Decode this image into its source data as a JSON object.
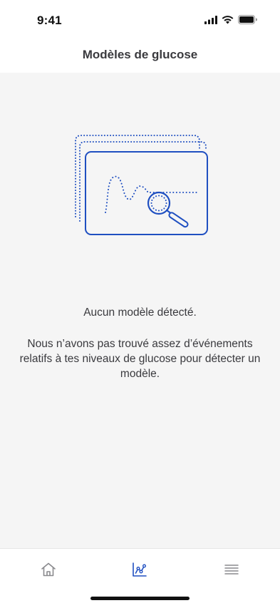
{
  "status_bar": {
    "time": "9:41",
    "icons": [
      "signal-icon",
      "wifi-icon",
      "battery-icon"
    ]
  },
  "header": {
    "title": "Modèles de glucose"
  },
  "empty_state": {
    "illustration": "magnifier-over-graph-illustration",
    "title": "Aucun modèle détecté.",
    "description": "Nous n’avons pas trouvé assez d’événements relatifs à tes niveaux de glucose pour détecter un modèle."
  },
  "tab_bar": {
    "tabs": [
      {
        "icon": "home-icon",
        "active": false
      },
      {
        "icon": "chart-icon",
        "active": true
      },
      {
        "icon": "menu-icon",
        "active": false
      }
    ],
    "active_color": "#1F4FC1",
    "inactive_color": "#8A8A8E"
  },
  "colors": {
    "background": "#F5F5F5",
    "accent": "#1F4FC1"
  }
}
